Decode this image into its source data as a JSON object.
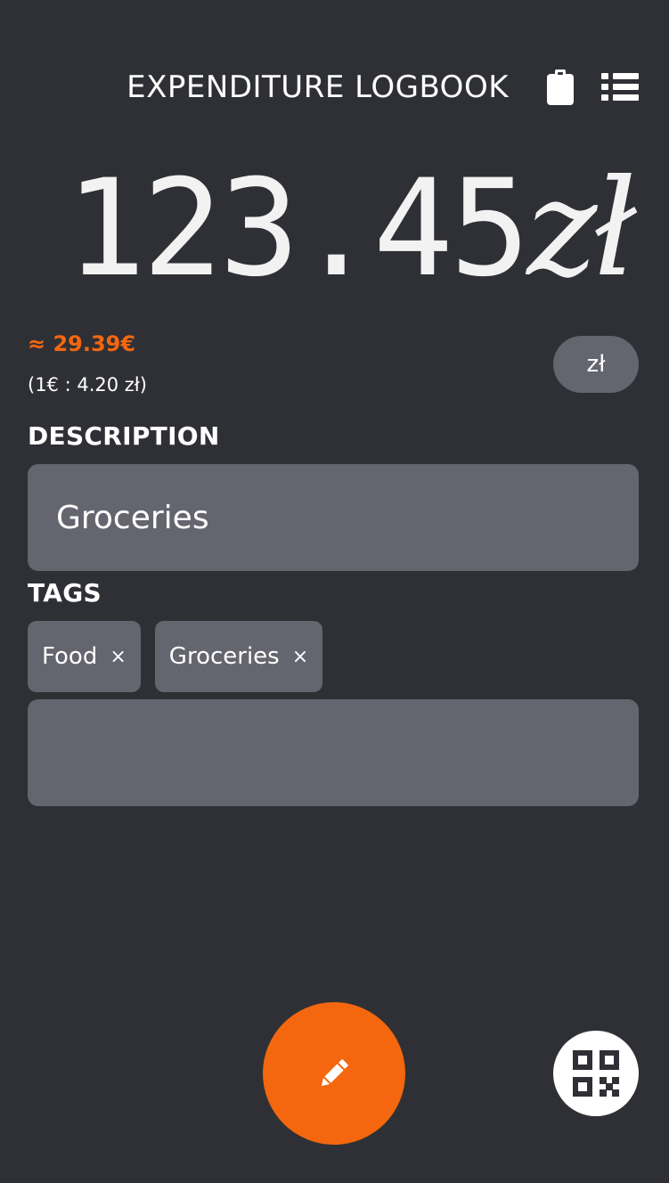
{
  "header": {
    "title": "EXPENDITURE LOGBOOK",
    "clipboard_icon": "clipboard-icon",
    "list_icon": "list-icon"
  },
  "amount": {
    "value": "123.45",
    "currency_symbol": "zł"
  },
  "conversion": {
    "approx": "≈ 29.39€",
    "rate": "(1€ : 4.20 zł)"
  },
  "currency_button": {
    "label": "zł"
  },
  "description": {
    "label": "DESCRIPTION",
    "value": "Groceries"
  },
  "tags": {
    "label": "TAGS",
    "items": [
      {
        "label": "Food",
        "remove": "×"
      },
      {
        "label": "Groceries",
        "remove": "×"
      }
    ],
    "input_value": ""
  },
  "actions": {
    "edit_icon": "pencil-icon",
    "qr_icon": "qr-code-icon"
  },
  "colors": {
    "background": "#2f3035",
    "accent": "#f4670e",
    "field": "#64656f",
    "text": "#ffffff"
  }
}
